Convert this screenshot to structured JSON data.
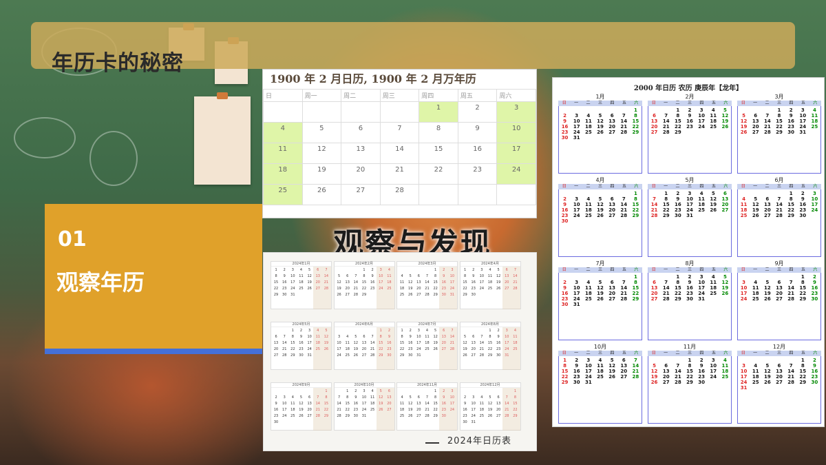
{
  "slide": {
    "title": "年历卡的秘密",
    "section_number": "01",
    "section_title": "观察年历",
    "headline": "观察与发现"
  },
  "calendar_1900": {
    "header": "1900 年  2 月日历, 1900 年  2 月万年历",
    "weekdays": [
      "日",
      "周一",
      "周二",
      "周三",
      "周四",
      "周五",
      "周六"
    ],
    "rows": [
      [
        "",
        "",
        "",
        "",
        "1",
        "2",
        "3"
      ],
      [
        "4",
        "5",
        "6",
        "7",
        "8",
        "9",
        "10"
      ],
      [
        "11",
        "12",
        "13",
        "14",
        "15",
        "16",
        "17"
      ],
      [
        "18",
        "19",
        "20",
        "21",
        "22",
        "23",
        "24"
      ],
      [
        "25",
        "26",
        "27",
        "28",
        "",
        "",
        ""
      ]
    ]
  },
  "calendar_2024": {
    "footer": "2024年日历表",
    "months": [
      "2024年1月",
      "2024年2月",
      "2024年3月",
      "2024年4月",
      "2024年5月",
      "2024年6月",
      "2024年7月",
      "2024年8月",
      "2024年9月",
      "2024年10月",
      "2024年11月",
      "2024年12月"
    ]
  },
  "calendar_2000": {
    "header": "2000 年日历      农历   庚辰年【龙年】",
    "weekdays": [
      "日",
      "一",
      "二",
      "三",
      "四",
      "五",
      "六"
    ],
    "months": [
      "1月",
      "2月",
      "3月",
      "4月",
      "5月",
      "6月",
      "7月",
      "8月",
      "9月",
      "10月",
      "11月",
      "12月"
    ]
  }
}
